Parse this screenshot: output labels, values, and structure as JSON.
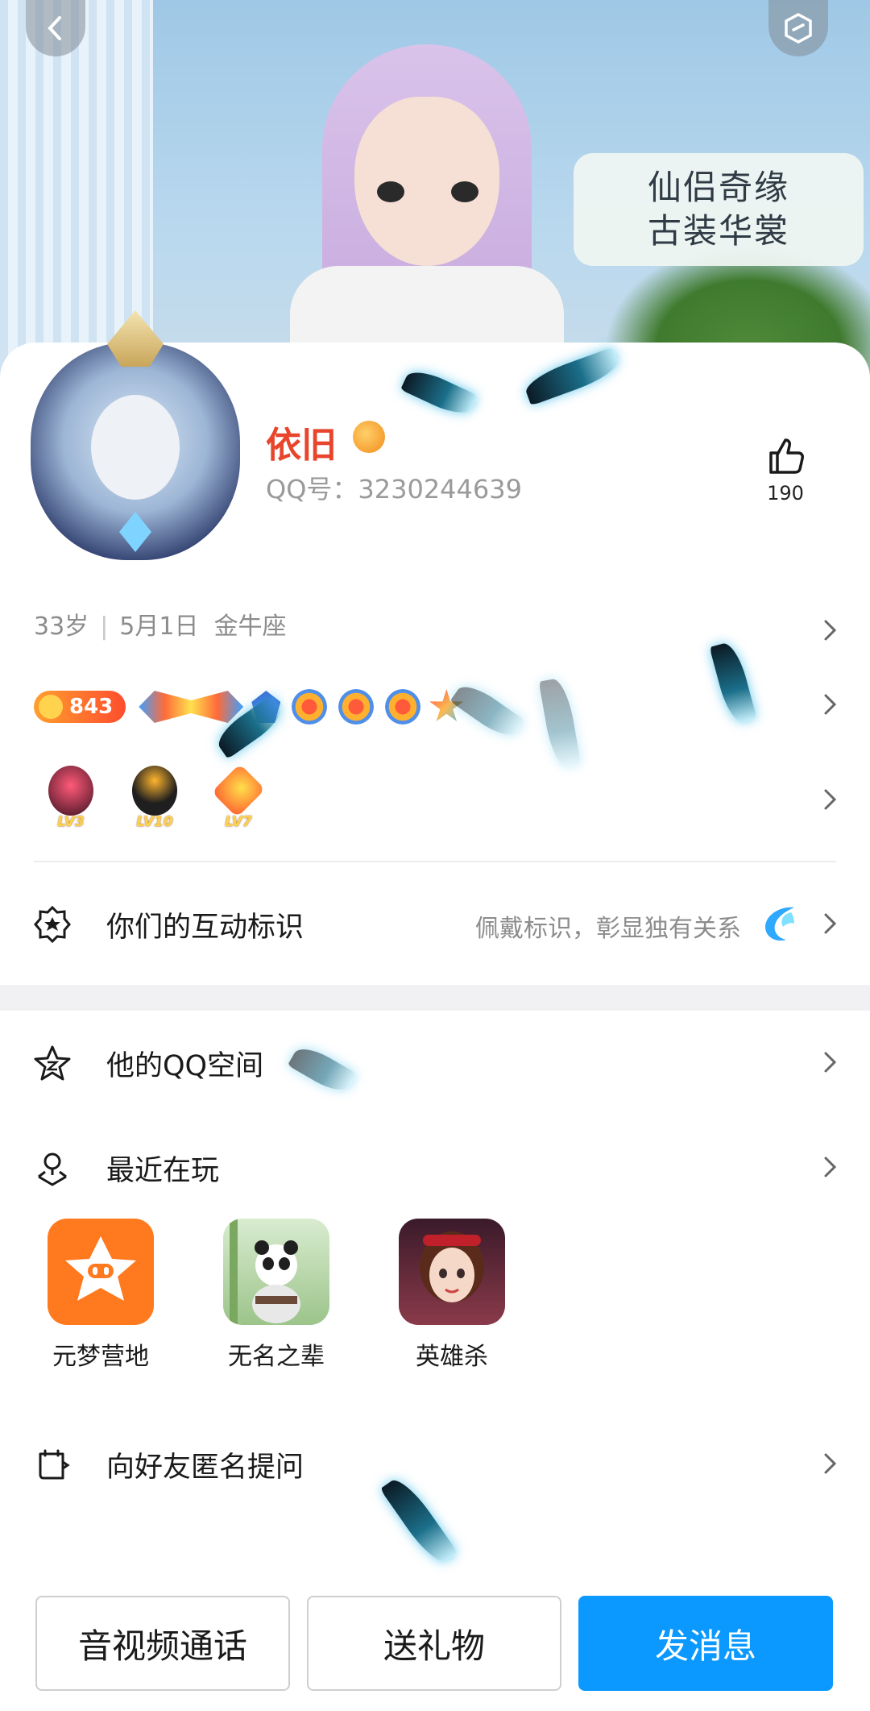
{
  "colors": {
    "accent": "#0b99ff",
    "nickname": "#e8452c",
    "muted": "#8c8c8c"
  },
  "banner": {
    "ad_line1": "仙侣奇缘",
    "ad_line2": "古装华裳"
  },
  "profile": {
    "nickname": "依旧",
    "qq_number": "QQ号：3230244639",
    "likes": "190",
    "age": "33岁",
    "birthday": "5月1日",
    "zodiac": "金牛座",
    "coin_count": "843"
  },
  "levels": [
    {
      "label": "LV3",
      "color": "#d2465a"
    },
    {
      "label": "LV10",
      "color": "#1f1f1f"
    },
    {
      "label": "LV7",
      "color": "#ff8a2e"
    }
  ],
  "rows": {
    "interaction_mark": {
      "label": "你们的互动标识",
      "hint": "佩戴标识，彰显独有关系"
    },
    "qzone": {
      "label": "他的QQ空间"
    },
    "recent_play": {
      "label": "最近在玩"
    },
    "anonymous_ask": {
      "label": "向好友匿名提问"
    }
  },
  "apps": [
    {
      "name": "元梦营地",
      "icon": "star-face-icon",
      "color": "#ff7a1f"
    },
    {
      "name": "无名之辈",
      "icon": "panda-icon",
      "color": "#b8d8a8"
    },
    {
      "name": "英雄杀",
      "icon": "hero-portrait-icon",
      "color": "#6a2a3a"
    }
  ],
  "buttons": {
    "call": "音视频通话",
    "gift": "送礼物",
    "message": "发消息"
  }
}
